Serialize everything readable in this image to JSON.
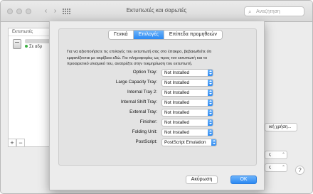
{
  "window": {
    "title": "Εκτυπωτές και σαρωτές",
    "search_placeholder": "Αναζήτηση"
  },
  "printers_list": {
    "header": "Εκτυπωτές",
    "items": [
      {
        "status": "Σε αδρ"
      }
    ],
    "add_label": "+",
    "remove_label": "−"
  },
  "background": {
    "options_button": "ική χρήση...",
    "select_1": "ς",
    "select_2": "ς",
    "help": "?"
  },
  "sheet": {
    "tabs": [
      {
        "label": "Γενικά",
        "active": false
      },
      {
        "label": "Επιλογές",
        "active": true
      },
      {
        "label": "Επίπεδα προμηθειών",
        "active": false
      }
    ],
    "intro": "Για να αξιοποιήσετε τις επιλογές του εκτυπωτή σας στο έπακρο, βεβαιωθείτε ότι εμφανίζονται με ακρίβεια εδώ. Για πληροφορίες ως προς τον εκτυπωτή και το προαιρετικό υλισμικό του, ανατρέξτε στην τεκμηρίωση του εκτυπωτή.",
    "options": [
      {
        "label": "Option Tray:",
        "value": "Not Installed"
      },
      {
        "label": "Large Capacity Tray:",
        "value": "Not Installed"
      },
      {
        "label": "Internal Tray 2:",
        "value": "Not Installed"
      },
      {
        "label": "Internal Shift Tray:",
        "value": "Not Installed"
      },
      {
        "label": "External Tray:",
        "value": "Not Installed"
      },
      {
        "label": "Finisher:",
        "value": "Not Installed"
      },
      {
        "label": "Folding Unit:",
        "value": "Not Installed"
      },
      {
        "label": "PostScript:",
        "value": "PostScript Emulation"
      }
    ],
    "cancel_label": "Ακύρωση",
    "ok_label": "OK"
  },
  "colors": {
    "accent": "#2b89f3",
    "window_bg": "#ececec"
  }
}
